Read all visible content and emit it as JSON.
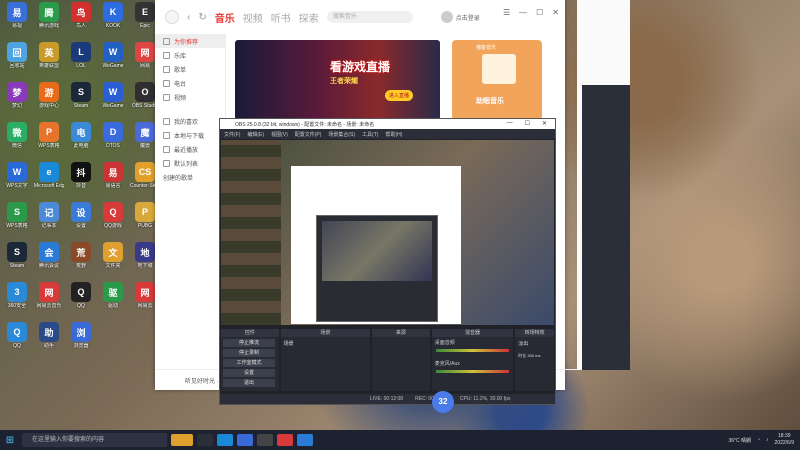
{
  "desktop": {
    "icons": [
      {
        "label": "易视",
        "color": "#3b6fd8",
        "glyph": "易"
      },
      {
        "label": "腾讯游戏",
        "color": "#2b9a4a",
        "glyph": "腾"
      },
      {
        "label": "鸟人",
        "color": "#d32f2f",
        "glyph": "鸟"
      },
      {
        "label": "KOOK",
        "color": "#2d6be0",
        "glyph": "K"
      },
      {
        "label": "Epic",
        "color": "#333",
        "glyph": "E"
      },
      {
        "label": "回收站",
        "color": "#4fa3e0",
        "glyph": "回"
      },
      {
        "label": "英雄联盟",
        "color": "#c99a2a",
        "glyph": "英"
      },
      {
        "label": "LOL",
        "color": "#1a3a7a",
        "glyph": "L"
      },
      {
        "label": "WeGame",
        "color": "#2260c4",
        "glyph": "W"
      },
      {
        "label": "网易",
        "color": "#d44",
        "glyph": "网"
      },
      {
        "label": "梦幻",
        "color": "#8a3ab9",
        "glyph": "梦"
      },
      {
        "label": "游戏中心",
        "color": "#e96a1a",
        "glyph": "游"
      },
      {
        "label": "Steam",
        "color": "#1b2838",
        "glyph": "S"
      },
      {
        "label": "WeGame",
        "color": "#2a5ed4",
        "glyph": "W"
      },
      {
        "label": "OBS Studio",
        "color": "#302e31",
        "glyph": "O"
      },
      {
        "label": "微信",
        "color": "#2aae67",
        "glyph": "微"
      },
      {
        "label": "WPS表格",
        "color": "#e5732a",
        "glyph": "P"
      },
      {
        "label": "此电脑",
        "color": "#3a8ad8",
        "glyph": "电"
      },
      {
        "label": "DTOS",
        "color": "#3a6ae0",
        "glyph": "D"
      },
      {
        "label": "魔兽",
        "color": "#4a6ad8",
        "glyph": "魔"
      },
      {
        "label": "WPS文字",
        "color": "#2a6ad8",
        "glyph": "W"
      },
      {
        "label": "Microsoft Edge",
        "color": "#1a8ad8",
        "glyph": "e"
      },
      {
        "label": "抖音",
        "color": "#111",
        "glyph": "抖"
      },
      {
        "label": "易语言",
        "color": "#c33",
        "glyph": "易"
      },
      {
        "label": "Counter-Strike Global...",
        "color": "#e0a02a",
        "glyph": "CS"
      },
      {
        "label": "WPS表格",
        "color": "#2a9a4a",
        "glyph": "S"
      },
      {
        "label": "记事本",
        "color": "#4a8ad8",
        "glyph": "记"
      },
      {
        "label": "设置",
        "color": "#3a7ad8",
        "glyph": "设"
      },
      {
        "label": "QQ游戏",
        "color": "#d83a3a",
        "glyph": "Q"
      },
      {
        "label": "PUBG",
        "color": "#d8a83a",
        "glyph": "P"
      },
      {
        "label": "Steam",
        "color": "#1b2838",
        "glyph": "S"
      },
      {
        "label": "腾讯会议",
        "color": "#2a7ad8",
        "glyph": "会"
      },
      {
        "label": "荒野",
        "color": "#8a4a2a",
        "glyph": "荒"
      },
      {
        "label": "文件夹",
        "color": "#e0a030",
        "glyph": "文"
      },
      {
        "label": "地下城",
        "color": "#3a3a8a",
        "glyph": "地"
      },
      {
        "label": "360安全",
        "color": "#2a8ad8",
        "glyph": "3"
      },
      {
        "label": "网易云音乐",
        "color": "#d83a3a",
        "glyph": "网"
      },
      {
        "label": "QQ",
        "color": "#222",
        "glyph": "Q"
      },
      {
        "label": "驱动",
        "color": "#2a9a4a",
        "glyph": "驱"
      },
      {
        "label": "网易云",
        "color": "#d83a3a",
        "glyph": "网"
      },
      {
        "label": "QQ",
        "color": "#2a8ad8",
        "glyph": "Q"
      },
      {
        "label": "助手",
        "color": "#2a4a8a",
        "glyph": "助"
      },
      {
        "label": "浏览器",
        "color": "#3a6ad8",
        "glyph": "浏"
      }
    ]
  },
  "music_app": {
    "nav": [
      "音乐",
      "视频",
      "听书",
      "探索"
    ],
    "search_placeholder": "搜索音乐",
    "user": "点击登录",
    "sidebar": [
      "为你推荐",
      "乐库",
      "歌单",
      "电台",
      "视频",
      "我的喜欢",
      "本地与下载",
      "最近播放",
      "默认列表",
      "创建的歌单"
    ],
    "banner_title": "看游戏直播",
    "banner_sub": "王者荣耀",
    "banner_btn": "进入直播",
    "card_head": "播客音乐",
    "card_title": "助眠音乐",
    "player_text": "听见好时光 · 音乐"
  },
  "obs": {
    "title": "OBS 25.0.8 (32 bit, windows) - 配置文件: 未命名 - 场景: 未命名",
    "menu": [
      "文件(F)",
      "编辑(E)",
      "视图(V)",
      "配置文件(P)",
      "场景集合(S)",
      "工具(T)",
      "帮助(H)"
    ],
    "panels": {
      "controls": "控件",
      "scenes": "场景",
      "sources": "来源",
      "mixer": "混音器",
      "transitions": "转场特效"
    },
    "controls": [
      "停止推流",
      "停止录制",
      "工作室模式",
      "设置",
      "退出"
    ],
    "scene_item": "场景",
    "mixer": [
      "桌面音频",
      "麦克风/Aux"
    ],
    "transition": "淡出",
    "duration": "时长 300 ms",
    "status": [
      "LIVE: 00:12:08",
      "REC: 00:00:00",
      "CPU: 11.2%, 30.00 fps"
    ],
    "badge": "32"
  },
  "taskbar": {
    "search": "在这里输入你要搜索的内容",
    "weather": "36°C 晴朗",
    "time": "18:39",
    "date": "2022/6/9"
  }
}
